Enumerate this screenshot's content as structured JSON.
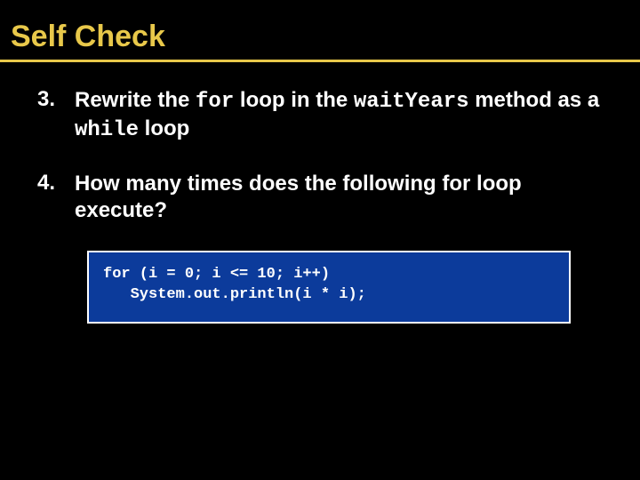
{
  "title": "Self Check",
  "items": [
    {
      "number": "3.",
      "segments": [
        {
          "t": "Rewrite the ",
          "mono": false
        },
        {
          "t": "for",
          "mono": true
        },
        {
          "t": " loop in the ",
          "mono": false
        },
        {
          "t": "waitYears",
          "mono": true
        },
        {
          "t": " method as a ",
          "mono": false
        },
        {
          "t": "while",
          "mono": true
        },
        {
          "t": " loop",
          "mono": false
        }
      ]
    },
    {
      "number": "4.",
      "segments": [
        {
          "t": "How many times does the following for loop execute?",
          "mono": false
        }
      ]
    }
  ],
  "code": "for (i = 0; i <= 10; i++)\n   System.out.println(i * i);"
}
